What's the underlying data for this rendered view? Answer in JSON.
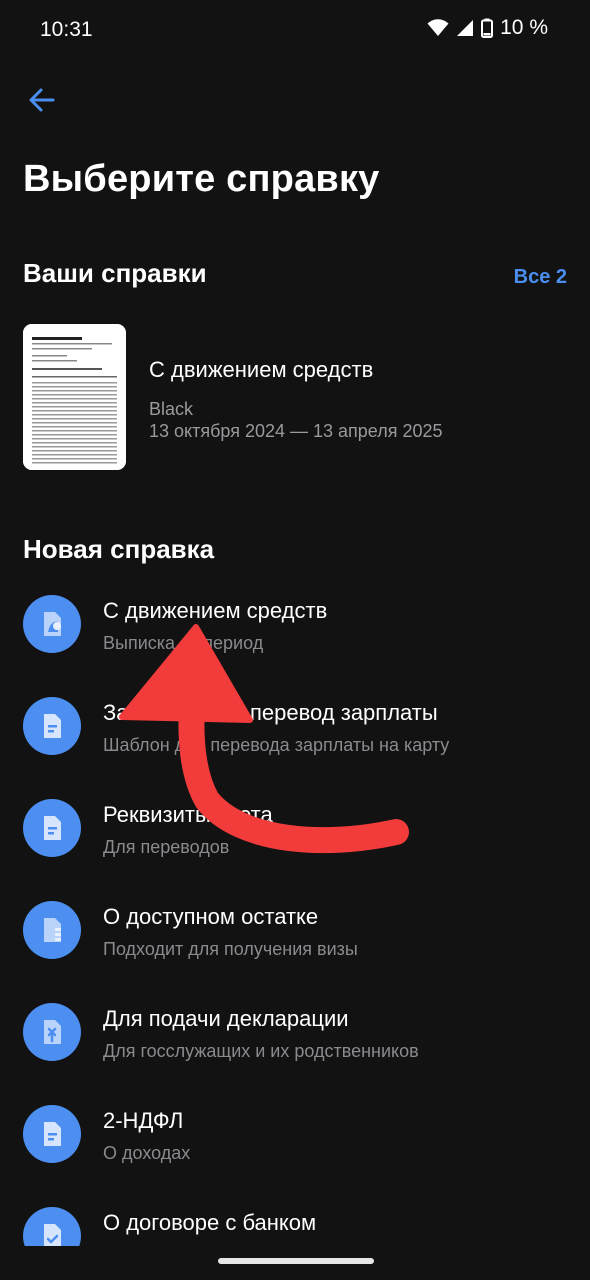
{
  "status": {
    "time": "10:31",
    "battery": "10 %"
  },
  "header": {
    "title": "Выберите справку"
  },
  "your_docs": {
    "title": "Ваши справки",
    "see_all": "Все 2",
    "card": {
      "title": "С движением средств",
      "account": "Black",
      "period": "13 октября 2024 — 13 апреля 2025"
    }
  },
  "new_doc": {
    "title": "Новая справка",
    "items": [
      {
        "title": "С движением средств",
        "subtitle": "Выписка за период",
        "icon": "document-chart-icon"
      },
      {
        "title": "Заявление на перевод зарплаты",
        "subtitle": "Шаблон для перевода зарплаты на карту",
        "icon": "document-icon"
      },
      {
        "title": "Реквизиты счета",
        "subtitle": "Для переводов",
        "icon": "document-icon"
      },
      {
        "title": "О доступном остатке",
        "subtitle": "Подходит для получения визы",
        "icon": "document-balance-icon"
      },
      {
        "title": "Для подачи декларации",
        "subtitle": "Для госслужащих и их родственников",
        "icon": "document-declaration-icon"
      },
      {
        "title": "2-НДФЛ",
        "subtitle": "О доходах",
        "icon": "document-icon"
      },
      {
        "title": "О договоре с банком",
        "subtitle": "",
        "icon": "document-check-icon"
      }
    ]
  },
  "colors": {
    "accent": "#4a8ff0",
    "icon_bg": "#4c8ff1",
    "arrow": "#f23b3b",
    "background": "#121212"
  }
}
